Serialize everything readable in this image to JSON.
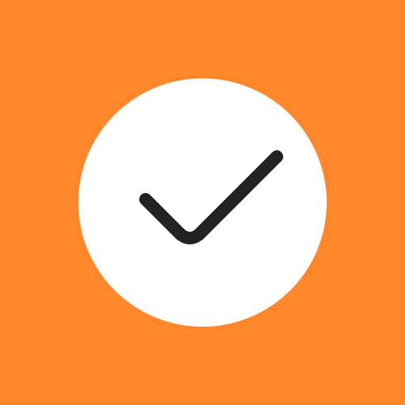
{
  "icon": {
    "name": "checkmark-circle-icon",
    "background_color": "#FF8629",
    "circle_color": "#FFFFFF",
    "check_color": "#222222"
  }
}
